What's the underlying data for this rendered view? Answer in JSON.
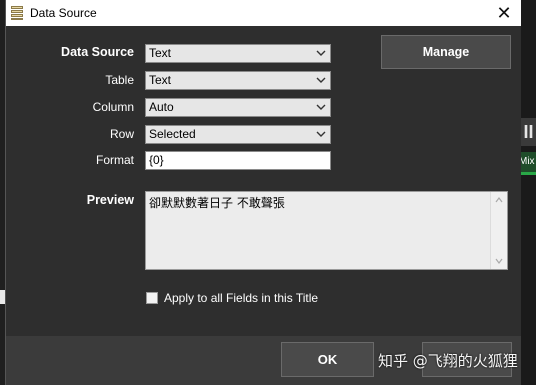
{
  "window": {
    "title": "Data Source",
    "close_glyph": "✕"
  },
  "form": {
    "data_source": {
      "label": "Data Source",
      "value": "Text"
    },
    "table": {
      "label": "Table",
      "value": "Text"
    },
    "column": {
      "label": "Column",
      "value": "Auto"
    },
    "row": {
      "label": "Row",
      "value": "Selected"
    },
    "format": {
      "label": "Format",
      "value": "{0}"
    }
  },
  "manage_button": "Manage",
  "preview": {
    "label": "Preview",
    "text": "卻默默數著日子 不敢聲張"
  },
  "apply_all": {
    "label": "Apply to all Fields in this Title",
    "checked": false
  },
  "footer": {
    "ok": "OK"
  },
  "background": {
    "right_button": "II",
    "right_green_label": "Mix"
  },
  "watermark": "知乎 @飞翔的火狐狸",
  "colors": {
    "dialog_bg": "#2e2e2e",
    "footer_bg": "#3b3b3b",
    "button_bg": "#4a4a4a",
    "accent_green": "#29a847"
  }
}
